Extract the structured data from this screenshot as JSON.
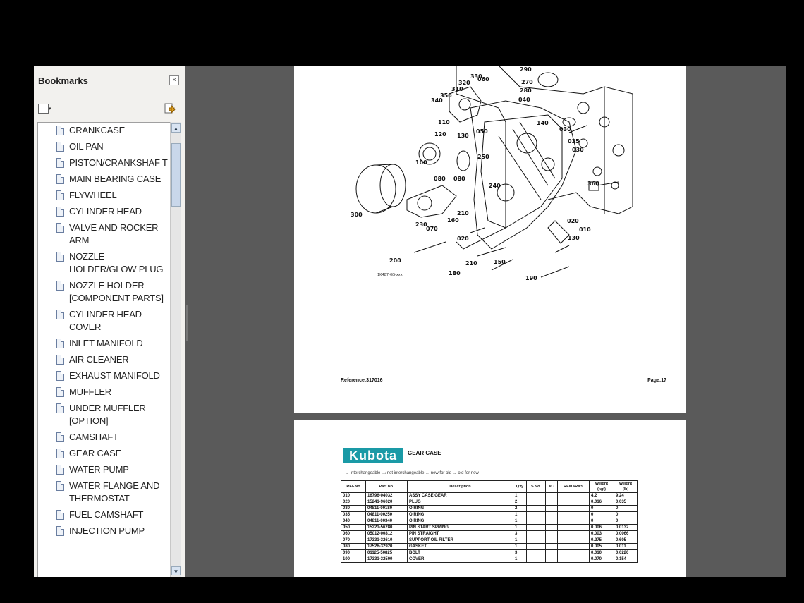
{
  "sidebar": {
    "title": "Bookmarks",
    "close_glyph": "×",
    "options_glyph": "▾",
    "items": [
      {
        "label": "CRANKCASE"
      },
      {
        "label": "OIL PAN"
      },
      {
        "label": "PISTON/CRANKSHAF T"
      },
      {
        "label": "MAIN BEARING CASE"
      },
      {
        "label": "FLYWHEEL"
      },
      {
        "label": "CYLINDER HEAD"
      },
      {
        "label": "VALVE AND ROCKER ARM"
      },
      {
        "label": "NOZZLE HOLDER/GLOW PLUG"
      },
      {
        "label": "NOZZLE HOLDER [COMPONENT PARTS]"
      },
      {
        "label": "CYLINDER HEAD COVER"
      },
      {
        "label": "INLET MANIFOLD"
      },
      {
        "label": "AIR CLEANER"
      },
      {
        "label": "EXHAUST MANIFOLD"
      },
      {
        "label": "MUFFLER"
      },
      {
        "label": "UNDER MUFFLER [OPTION]"
      },
      {
        "label": "CAMSHAFT"
      },
      {
        "label": "GEAR CASE"
      },
      {
        "label": "WATER PUMP"
      },
      {
        "label": "WATER FLANGE AND THERMOSTAT"
      },
      {
        "label": "FUEL CAMSHAFT"
      },
      {
        "label": "INJECTION PUMP"
      }
    ]
  },
  "page1": {
    "footer_ref": "Reference:317016",
    "footer_page": "Page:17",
    "drawing_labels": [
      "330",
      "320",
      "310",
      "350",
      "340",
      "110",
      "120",
      "130",
      "050",
      "100",
      "250",
      "080",
      "080",
      "300",
      "240",
      "230",
      "070",
      "160",
      "020",
      "210",
      "200",
      "210",
      "150",
      "180",
      "190",
      "060",
      "290",
      "270",
      "280",
      "040",
      "140",
      "030",
      "035",
      "030",
      "360",
      "020",
      "010",
      "130",
      "190"
    ],
    "figure_code": "1K487-GS-xxx"
  },
  "page2": {
    "logo_text": "Kubota",
    "title": "GEAR CASE",
    "legend": "↔ interchangeable   ↛ not interchangeable   ← new for old   → old for new",
    "table": {
      "headers": [
        "REF.No",
        "Part No.",
        "Description",
        "Q'ty",
        "S.No.",
        "I/C",
        "REMARKS",
        "Weight (kgf)",
        "Weight (lb)"
      ],
      "rows": [
        [
          "010",
          "16796-04032",
          "ASSY CASE GEAR",
          "1",
          "",
          "",
          "",
          "4.2",
          "9.24"
        ],
        [
          "020",
          "15241-96020",
          "PLUG",
          "2",
          "",
          "",
          "",
          "0.016",
          "0.035"
        ],
        [
          "030",
          "04811-00180",
          "O RING",
          "2",
          "",
          "",
          "",
          "0",
          "0"
        ],
        [
          "035",
          "04811-00250",
          "O RING",
          "1",
          "",
          "",
          "",
          "0",
          "0"
        ],
        [
          "040",
          "04811-00340",
          "O RING",
          "1",
          "",
          "",
          "",
          "0",
          "0"
        ],
        [
          "050",
          "15221-56280",
          "PIN START SPRING",
          "1",
          "",
          "",
          "",
          "0.006",
          "0.0132"
        ],
        [
          "060",
          "05012-00812",
          "PIN STRAIGHT",
          "3",
          "",
          "",
          "",
          "0.003",
          "0.0066"
        ],
        [
          "070",
          "17331-32610",
          "SUPPORT OIL FILTER",
          "1",
          "",
          "",
          "",
          "0.275",
          "0.605"
        ],
        [
          "080",
          "17526-32920",
          "GASKET",
          "1",
          "",
          "",
          "",
          "0.005",
          "0.011"
        ],
        [
          "090",
          "01125-50825",
          "BOLT",
          "3",
          "",
          "",
          "",
          "0.010",
          "0.0220"
        ],
        [
          "100",
          "17331-32500",
          "COVER",
          "1",
          "",
          "",
          "",
          "0.070",
          "0.154"
        ]
      ]
    }
  }
}
